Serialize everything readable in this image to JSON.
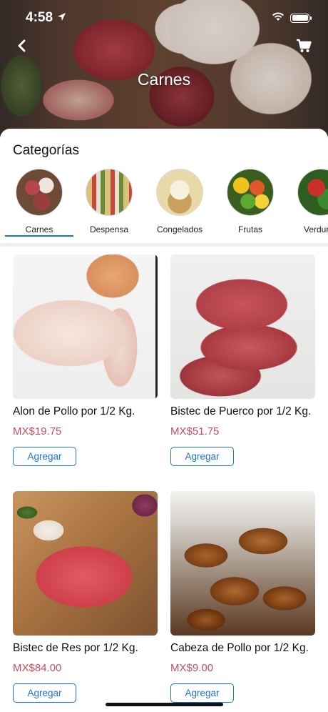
{
  "status_bar": {
    "time": "4:58"
  },
  "header": {
    "title": "Carnes"
  },
  "categories": {
    "heading": "Categorías",
    "items": [
      {
        "label": "Carnes",
        "selected": true
      },
      {
        "label": "Despensa"
      },
      {
        "label": "Congelados"
      },
      {
        "label": "Frutas"
      },
      {
        "label": "Verduras"
      }
    ]
  },
  "products": [
    {
      "name": "Alon de Pollo por 1/2 Kg.",
      "price": "MX$19.75",
      "button": "Agregar"
    },
    {
      "name": "Bistec de Puerco por 1/2 Kg.",
      "price": "MX$51.75",
      "button": "Agregar"
    },
    {
      "name": "Bistec de Res por 1/2 Kg.",
      "price": "MX$84.00",
      "button": "Agregar"
    },
    {
      "name": "Cabeza de Pollo por 1/2 Kg.",
      "price": "MX$9.00",
      "button": "Agregar"
    }
  ],
  "colors": {
    "accent": "#1a73d9",
    "price": "#c0505d"
  }
}
